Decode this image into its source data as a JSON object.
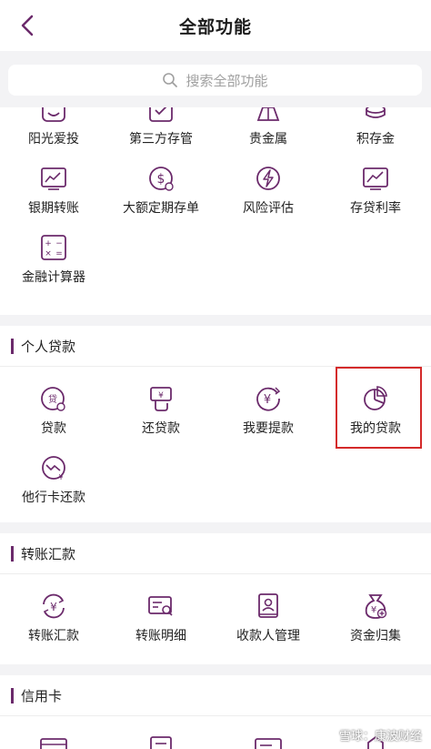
{
  "header": {
    "title": "全部功能"
  },
  "search": {
    "placeholder": "搜索全部功能"
  },
  "top_grid": {
    "items": [
      {
        "label": "阳光爱投",
        "icon": "face-icon"
      },
      {
        "label": "第三方存管",
        "icon": "check-box-icon"
      },
      {
        "label": "贵金属",
        "icon": "gold-bar-icon"
      },
      {
        "label": "积存金",
        "icon": "coin-stack-icon"
      },
      {
        "label": "银期转账",
        "icon": "chart-card-icon"
      },
      {
        "label": "大额定期存单",
        "icon": "dollar-coin-icon"
      },
      {
        "label": "风险评估",
        "icon": "lightning-icon"
      },
      {
        "label": "存贷利率",
        "icon": "rate-chart-icon"
      },
      {
        "label": "金融计算器",
        "icon": "calculator-icon"
      }
    ]
  },
  "personal_loan": {
    "title": "个人贷款",
    "items": [
      {
        "label": "贷款",
        "icon": "loan-icon"
      },
      {
        "label": "还贷款",
        "icon": "repay-icon"
      },
      {
        "label": "我要提款",
        "icon": "withdraw-icon"
      },
      {
        "label": "我的贷款",
        "icon": "pie-chart-icon"
      },
      {
        "label": "他行卡还款",
        "icon": "trend-coin-icon"
      }
    ]
  },
  "transfer": {
    "title": "转账汇款",
    "items": [
      {
        "label": "转账汇款",
        "icon": "transfer-icon"
      },
      {
        "label": "转账明细",
        "icon": "transfer-detail-icon"
      },
      {
        "label": "收款人管理",
        "icon": "payee-book-icon"
      },
      {
        "label": "资金归集",
        "icon": "money-bag-icon"
      }
    ]
  },
  "credit_card": {
    "title": "信用卡"
  },
  "watermark": "雪球：康波财经",
  "colors": {
    "accent": "#6b2a6b",
    "highlight": "#d42a2a",
    "background": "#f3f3f5"
  }
}
